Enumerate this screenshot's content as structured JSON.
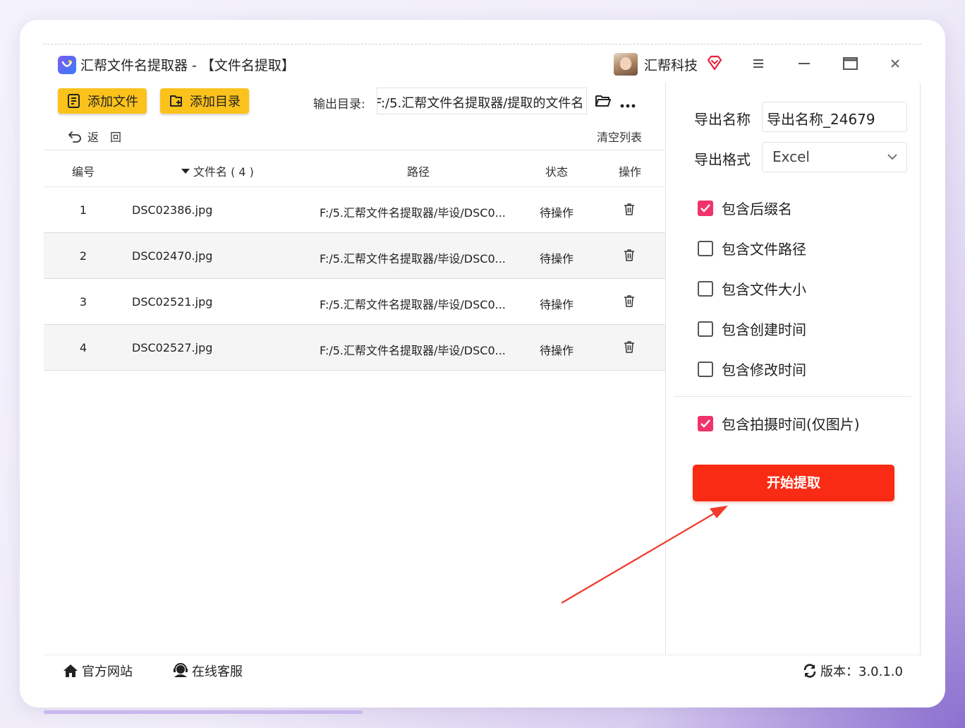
{
  "app": {
    "title": "汇帮文件名提取器 - 【文件名提取】",
    "brand": "汇帮科技"
  },
  "toolbar": {
    "add_file": "添加文件",
    "add_dir": "添加目录",
    "output_label": "输出目录:",
    "output_path": "F:/5.汇帮文件名提取器/提取的文件名",
    "back": "返　回",
    "clear": "清空列表"
  },
  "table": {
    "headers": {
      "num": "编号",
      "name": "文件名 ( 4 )",
      "path": "路径",
      "status": "状态",
      "op": "操作"
    },
    "rows": [
      {
        "num": "1",
        "name": "DSC02386.jpg",
        "path": "F:/5.汇帮文件名提取器/毕设/DSC0...",
        "status": "待操作"
      },
      {
        "num": "2",
        "name": "DSC02470.jpg",
        "path": "F:/5.汇帮文件名提取器/毕设/DSC0...",
        "status": "待操作"
      },
      {
        "num": "3",
        "name": "DSC02521.jpg",
        "path": "F:/5.汇帮文件名提取器/毕设/DSC0...",
        "status": "待操作"
      },
      {
        "num": "4",
        "name": "DSC02527.jpg",
        "path": "F:/5.汇帮文件名提取器/毕设/DSC0...",
        "status": "待操作"
      }
    ]
  },
  "side": {
    "export_name_label": "导出名称",
    "export_name_value": "导出名称_24679",
    "export_format_label": "导出格式",
    "export_format_value": "Excel",
    "options": [
      {
        "label": "包含后缀名",
        "checked": true
      },
      {
        "label": "包含文件路径",
        "checked": false
      },
      {
        "label": "包含文件大小",
        "checked": false
      },
      {
        "label": "包含创建时间",
        "checked": false
      },
      {
        "label": "包含修改时间",
        "checked": false
      },
      {
        "label": "包含拍摄时间(仅图片)",
        "checked": true
      }
    ],
    "start_button": "开始提取"
  },
  "footer": {
    "site": "官方网站",
    "service": "在线客服",
    "version": "版本：3.0.1.0"
  },
  "colors": {
    "accent_yellow": "#fbc21c",
    "start_red": "#fa2b14",
    "check_pink": "#f0336b"
  }
}
